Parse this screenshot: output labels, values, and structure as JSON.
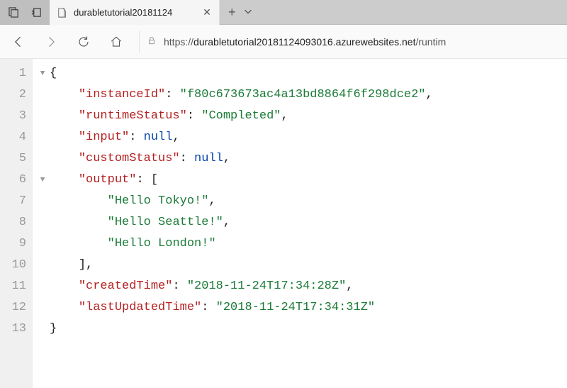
{
  "tab": {
    "title": "durabletutorial20181124"
  },
  "url": {
    "scheme": "https://",
    "host": "durabletutorial20181124093016.azurewebsites.net",
    "path": "/runtim"
  },
  "json_lines": [
    {
      "n": 1,
      "indent": 0,
      "fold": "▼",
      "tokens": [
        [
          "pun",
          "{"
        ]
      ]
    },
    {
      "n": 2,
      "indent": 1,
      "fold": "",
      "tokens": [
        [
          "key",
          "\"instanceId\""
        ],
        [
          "pun",
          ": "
        ],
        [
          "str",
          "\"f80c673673ac4a13bd8864f6f298dce2\""
        ],
        [
          "pun",
          ","
        ]
      ]
    },
    {
      "n": 3,
      "indent": 1,
      "fold": "",
      "tokens": [
        [
          "key",
          "\"runtimeStatus\""
        ],
        [
          "pun",
          ": "
        ],
        [
          "str",
          "\"Completed\""
        ],
        [
          "pun",
          ","
        ]
      ]
    },
    {
      "n": 4,
      "indent": 1,
      "fold": "",
      "tokens": [
        [
          "key",
          "\"input\""
        ],
        [
          "pun",
          ": "
        ],
        [
          "nul",
          "null"
        ],
        [
          "pun",
          ","
        ]
      ]
    },
    {
      "n": 5,
      "indent": 1,
      "fold": "",
      "tokens": [
        [
          "key",
          "\"customStatus\""
        ],
        [
          "pun",
          ": "
        ],
        [
          "nul",
          "null"
        ],
        [
          "pun",
          ","
        ]
      ]
    },
    {
      "n": 6,
      "indent": 1,
      "fold": "▼",
      "tokens": [
        [
          "key",
          "\"output\""
        ],
        [
          "pun",
          ": ["
        ]
      ]
    },
    {
      "n": 7,
      "indent": 2,
      "fold": "",
      "tokens": [
        [
          "str",
          "\"Hello Tokyo!\""
        ],
        [
          "pun",
          ","
        ]
      ]
    },
    {
      "n": 8,
      "indent": 2,
      "fold": "",
      "tokens": [
        [
          "str",
          "\"Hello Seattle!\""
        ],
        [
          "pun",
          ","
        ]
      ]
    },
    {
      "n": 9,
      "indent": 2,
      "fold": "",
      "tokens": [
        [
          "str",
          "\"Hello London!\""
        ]
      ]
    },
    {
      "n": 10,
      "indent": 1,
      "fold": "",
      "tokens": [
        [
          "pun",
          "],"
        ]
      ]
    },
    {
      "n": 11,
      "indent": 1,
      "fold": "",
      "tokens": [
        [
          "key",
          "\"createdTime\""
        ],
        [
          "pun",
          ": "
        ],
        [
          "str",
          "\"2018-11-24T17:34:28Z\""
        ],
        [
          "pun",
          ","
        ]
      ]
    },
    {
      "n": 12,
      "indent": 1,
      "fold": "",
      "tokens": [
        [
          "key",
          "\"lastUpdatedTime\""
        ],
        [
          "pun",
          ": "
        ],
        [
          "str",
          "\"2018-11-24T17:34:31Z\""
        ]
      ]
    },
    {
      "n": 13,
      "indent": 0,
      "fold": "",
      "tokens": [
        [
          "pun",
          "}"
        ]
      ]
    }
  ]
}
